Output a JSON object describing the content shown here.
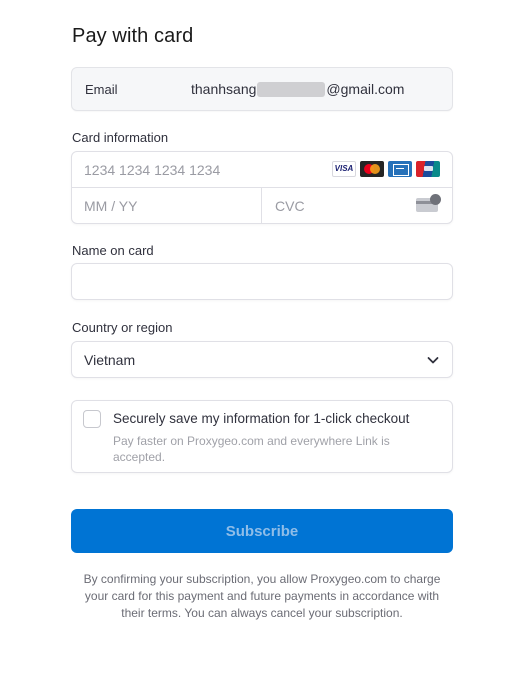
{
  "page": {
    "title": "Pay with card"
  },
  "email": {
    "label": "Email",
    "prefix": "thanhsang",
    "suffix": "@gmail.com"
  },
  "card": {
    "label": "Card information",
    "number_placeholder": "1234 1234 1234 1234",
    "expiry_placeholder": "MM / YY",
    "cvc_placeholder": "CVC",
    "brands": [
      "visa",
      "mastercard",
      "amex",
      "unionpay"
    ],
    "visa_text": "VISA"
  },
  "name": {
    "label": "Name on card",
    "value": ""
  },
  "country": {
    "label": "Country or region",
    "value": "Vietnam"
  },
  "save": {
    "title": "Securely save my information for 1-click checkout",
    "description": "Pay faster on Proxygeo.com and everywhere Link is accepted."
  },
  "subscribe": {
    "label": "Subscribe"
  },
  "terms": "By confirming your subscription, you allow Proxygeo.com to charge your card for this payment and future payments in accordance with their terms. You can always cancel your subscription.",
  "colors": {
    "primary": "#0074d4",
    "primary_text": "#8fbde8",
    "text": "#30313d",
    "muted": "#a0a1a8"
  }
}
